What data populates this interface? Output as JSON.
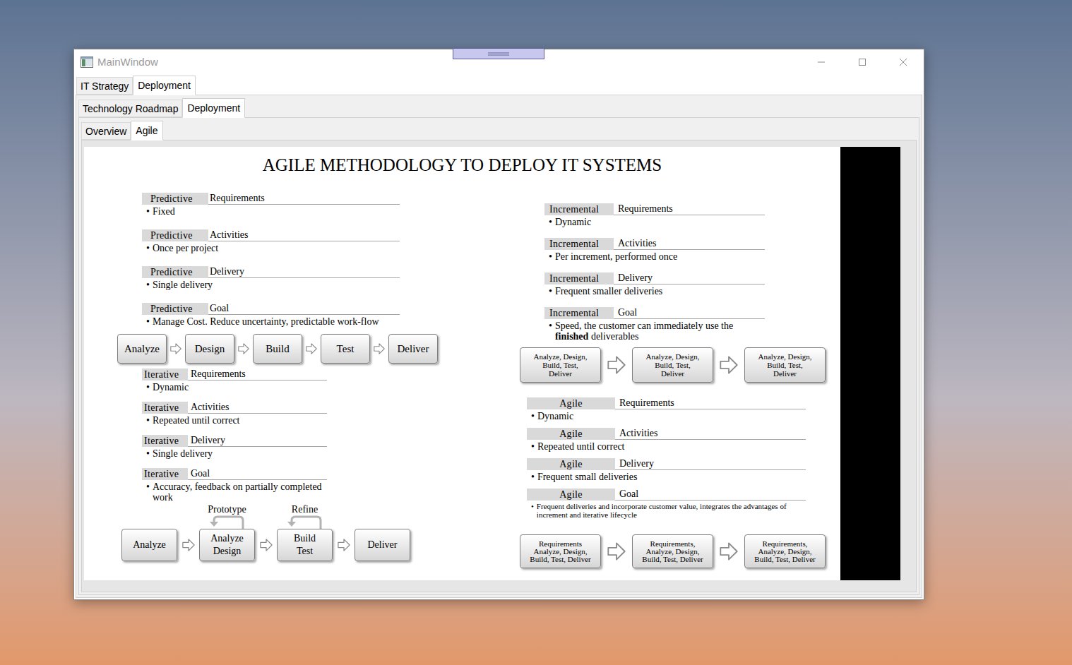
{
  "window": {
    "title": "MainWindow"
  },
  "tabs_level1": [
    {
      "label": "IT Strategy",
      "selected": false
    },
    {
      "label": "Deployment",
      "selected": true
    }
  ],
  "tabs_level2": [
    {
      "label": "Technology Roadmap",
      "selected": false
    },
    {
      "label": "Deployment",
      "selected": true
    }
  ],
  "tabs_level3": [
    {
      "label": "Overview",
      "selected": false
    },
    {
      "label": "Agile",
      "selected": true
    }
  ],
  "document": {
    "title": "AGILE METHODOLOGY TO DEPLOY IT SYSTEMS",
    "bullet_mark": "•",
    "columns": [
      {
        "quadrants": [
          {
            "name": "Predictive",
            "sections": [
              {
                "heading": "Requirements",
                "bullet": [
                  {
                    "text": "Fixed",
                    "bold": false
                  }
                ]
              },
              {
                "heading": "Activities",
                "bullet": [
                  {
                    "text": "Once per project",
                    "bold": false
                  }
                ]
              },
              {
                "heading": "Delivery",
                "bullet": [
                  {
                    "text": "Single delivery",
                    "bold": false
                  }
                ]
              },
              {
                "heading": "Goal",
                "bullet": [
                  {
                    "text": "Manage Cost. Reduce uncertainty, predictable work-flow",
                    "bold": false
                  }
                ]
              }
            ],
            "flow": [
              {
                "lines": [
                  "Analyze"
                ],
                "loop": null
              },
              {
                "lines": [
                  "Design"
                ],
                "loop": null
              },
              {
                "lines": [
                  "Build"
                ],
                "loop": null
              },
              {
                "lines": [
                  "Test"
                ],
                "loop": null
              },
              {
                "lines": [
                  "Deliver"
                ],
                "loop": null
              }
            ]
          },
          {
            "name": "Iterative",
            "sections": [
              {
                "heading": "Requirements",
                "bullet": [
                  {
                    "text": "Dynamic",
                    "bold": false
                  }
                ]
              },
              {
                "heading": "Activities",
                "bullet": [
                  {
                    "text": "Repeated until correct",
                    "bold": false
                  }
                ]
              },
              {
                "heading": "Delivery",
                "bullet": [
                  {
                    "text": "Single delivery",
                    "bold": false
                  }
                ]
              },
              {
                "heading": "Goal",
                "bullet": [
                  {
                    "text": "Accuracy, feedback on partially completed work",
                    "bold": false
                  }
                ]
              }
            ],
            "flow": [
              {
                "lines": [
                  "Analyze"
                ],
                "loop": null
              },
              {
                "lines": [
                  "Analyze",
                  "Design"
                ],
                "loop": "Prototype"
              },
              {
                "lines": [
                  "Build",
                  "Test"
                ],
                "loop": "Refine"
              },
              {
                "lines": [
                  "Deliver"
                ],
                "loop": null
              }
            ]
          }
        ]
      },
      {
        "quadrants": [
          {
            "name": "Incremental",
            "sections": [
              {
                "heading": "Requirements",
                "bullet": [
                  {
                    "text": "Dynamic",
                    "bold": false
                  }
                ]
              },
              {
                "heading": "Activities",
                "bullet": [
                  {
                    "text": "Per increment, performed once",
                    "bold": false
                  }
                ]
              },
              {
                "heading": "Delivery",
                "bullet": [
                  {
                    "text": "Frequent smaller deliveries",
                    "bold": false
                  }
                ]
              },
              {
                "heading": "Goal",
                "bullet": [
                  {
                    "text": "Speed, the customer can immediately use the ",
                    "bold": false
                  },
                  {
                    "text": "finished",
                    "bold": true
                  },
                  {
                    "text": " deliverables",
                    "bold": false
                  }
                ]
              }
            ],
            "flow": [
              {
                "lines": [
                  "Analyze, Design,",
                  "Build, Test,",
                  "Deliver"
                ],
                "loop": null
              },
              {
                "lines": [
                  "Analyze, Design,",
                  "Build, Test,",
                  "Deliver"
                ],
                "loop": null
              },
              {
                "lines": [
                  "Analyze, Design,",
                  "Build, Test,",
                  "Deliver"
                ],
                "loop": null
              }
            ]
          },
          {
            "name": "Agile",
            "sections": [
              {
                "heading": "Requirements",
                "bullet": [
                  {
                    "text": "Dynamic",
                    "bold": false
                  }
                ]
              },
              {
                "heading": "Activities",
                "bullet": [
                  {
                    "text": "Repeated until correct",
                    "bold": false
                  }
                ]
              },
              {
                "heading": "Delivery",
                "bullet": [
                  {
                    "text": "Frequent small deliveries",
                    "bold": false
                  }
                ]
              },
              {
                "heading": "Goal",
                "bullet": [
                  {
                    "text": "Frequent deliveries and incorporate customer value, integrates the advantages of increment and iterative lifecycle",
                    "bold": false
                  }
                ]
              }
            ],
            "flow": [
              {
                "lines": [
                  "Requirements",
                  "Analyze, Design,",
                  "Build, Test, Deliver"
                ],
                "loop": null
              },
              {
                "lines": [
                  "Requirements,",
                  "Analyze, Design,",
                  "Build, Test, Deliver"
                ],
                "loop": null
              },
              {
                "lines": [
                  "Requirements,",
                  "Analyze, Design,",
                  "Build, Test, Deliver"
                ],
                "loop": null
              }
            ]
          }
        ]
      }
    ]
  }
}
